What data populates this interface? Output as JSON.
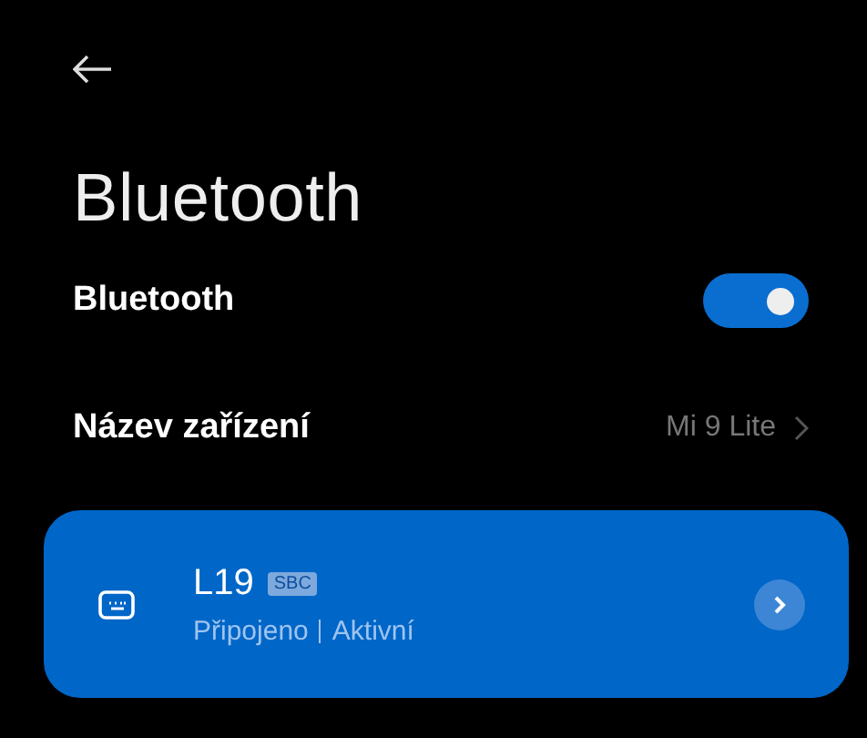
{
  "header": {
    "title": "Bluetooth"
  },
  "settings": [
    {
      "kind": "toggle",
      "label": "Bluetooth",
      "on": true
    },
    {
      "kind": "link",
      "label": "Název zařízení",
      "value": "Mi 9 Lite"
    }
  ],
  "devices": [
    {
      "name": "L19",
      "codec": "SBC",
      "status": [
        "Připojeno",
        "Aktivní"
      ],
      "selected": true
    }
  ]
}
